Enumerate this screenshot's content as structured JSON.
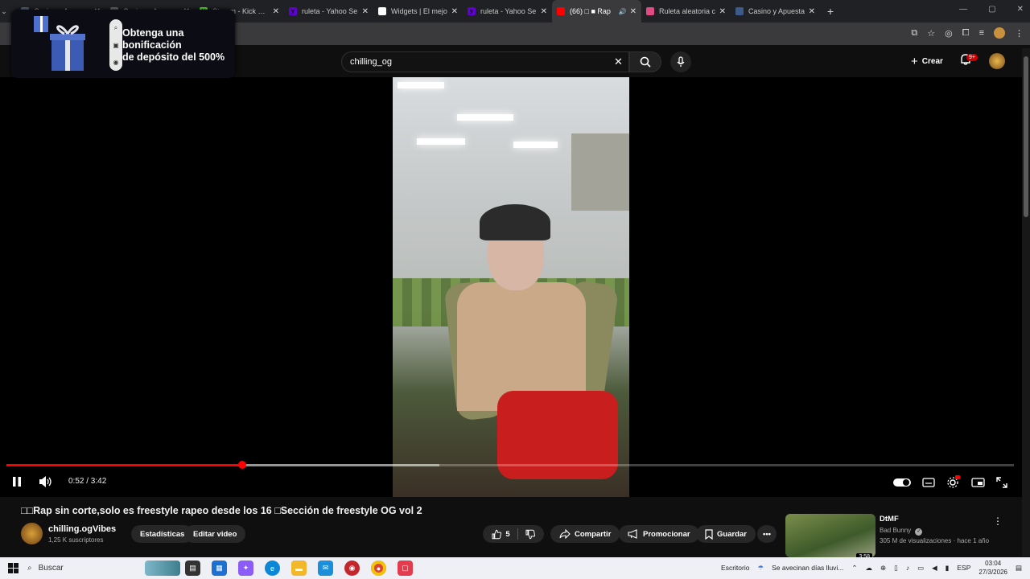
{
  "browser": {
    "tabs": [
      {
        "title": "Casino y Apuestas",
        "favicon_color": "#5b6b8a",
        "active": false
      },
      {
        "title": "Casino y Ap",
        "favicon_color": "#6d6d6d",
        "active": false
      },
      {
        "title": "Stream - Kick Dar",
        "favicon_color": "#53fc18",
        "favicon_letter": "K",
        "active": false
      },
      {
        "title": "ruleta - Yahoo Se",
        "favicon_color": "#6001d2",
        "favicon_letter": "y",
        "active": false
      },
      {
        "title": "Widgets | El mejo",
        "favicon_color": "#ffffff",
        "active": false
      },
      {
        "title": "ruleta - Yahoo Se",
        "favicon_color": "#6001d2",
        "favicon_letter": "y",
        "active": false
      },
      {
        "title": "(66) □ ■ Rap",
        "favicon_color": "#ff0000",
        "active": true
      },
      {
        "title": "Ruleta aleatoria c",
        "favicon_color": "#e14b84",
        "active": false
      },
      {
        "title": "Casino y Apuesta",
        "favicon_color": "#3d5b8a",
        "active": false
      }
    ]
  },
  "ad": {
    "line1": "Obtenga una",
    "line2": "bonificación",
    "line3": "de depósito del 500%"
  },
  "youtube": {
    "search_value": "chilling_og",
    "create_label": "Crear",
    "notif_badge": "9+"
  },
  "player": {
    "time_current": "0:52",
    "time_total": "3:42",
    "time_display": "0:52 / 3:42",
    "progress_fraction": 0.234,
    "buffered_fraction": 0.43
  },
  "video": {
    "title": "□□Rap sin corte,solo es freestyle rapeo desde los 16 □Sección de freestyle OG vol 2",
    "channel_name": "chilling.ogVibes",
    "subscribers": "1,25 K suscriptores",
    "stats_button": "Estadísticas",
    "edit_button": "Editar video",
    "likes": "5",
    "share_label": "Compartir",
    "promote_label": "Promocionar",
    "save_label": "Guardar"
  },
  "recommendation": {
    "title": "DtMF",
    "artist": "Bad Bunny",
    "meta": "305 M de visualizaciones · hace 1 año",
    "duration": "3:58"
  },
  "taskbar": {
    "search_placeholder": "Buscar",
    "desktop_label": "Escritorio",
    "weather": "Se avecinan días lluvi...",
    "language": "ESP",
    "time": "03:04",
    "date": "27/3/2026"
  }
}
